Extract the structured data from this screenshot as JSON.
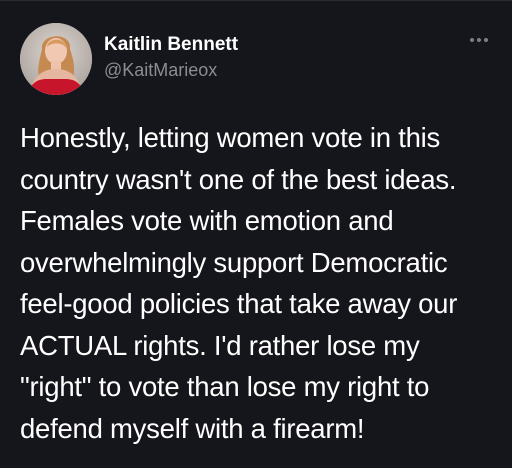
{
  "tweet": {
    "author": {
      "display_name": "Kaitlin Bennett",
      "handle": "@KaitMarieox"
    },
    "menu_icon": "more-horizontal-icon",
    "text_lines": [
      "Honestly, letting women vote in this",
      "country wasn't one of the best ideas.",
      "Females vote with emotion and",
      "overwhelmingly support Democratic",
      "feel-good policies that take away our",
      "ACTUAL rights. I'd rather lose my",
      "\"right\" to vote than lose my right to",
      "defend myself with a firearm!"
    ]
  },
  "colors": {
    "background": "#15151c",
    "primary_text": "#ffffff",
    "secondary_text": "#8a8d91"
  }
}
